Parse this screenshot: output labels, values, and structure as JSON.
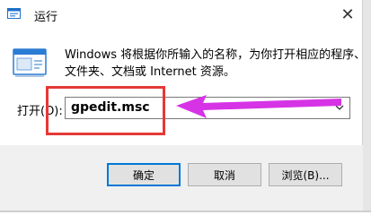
{
  "window": {
    "title": "运行",
    "close_glyph": "✕"
  },
  "description": {
    "line1": "Windows 将根据你所输入的名称，为你打开相应的程序、",
    "line2": "文件夹、文档或 Internet 资源。"
  },
  "open_field": {
    "label": "打开(O):",
    "value": "gpedit.msc"
  },
  "buttons": {
    "ok": "确定",
    "cancel": "取消",
    "browse": "浏览(B)..."
  },
  "colors": {
    "highlight": "#e53935",
    "pointer_arrow": "#d633e6",
    "accent": "#0078d7"
  },
  "icons": {
    "title": "run-icon",
    "app": "run-app-icon",
    "close": "close-icon",
    "dropdown": "chevron-down-icon"
  }
}
